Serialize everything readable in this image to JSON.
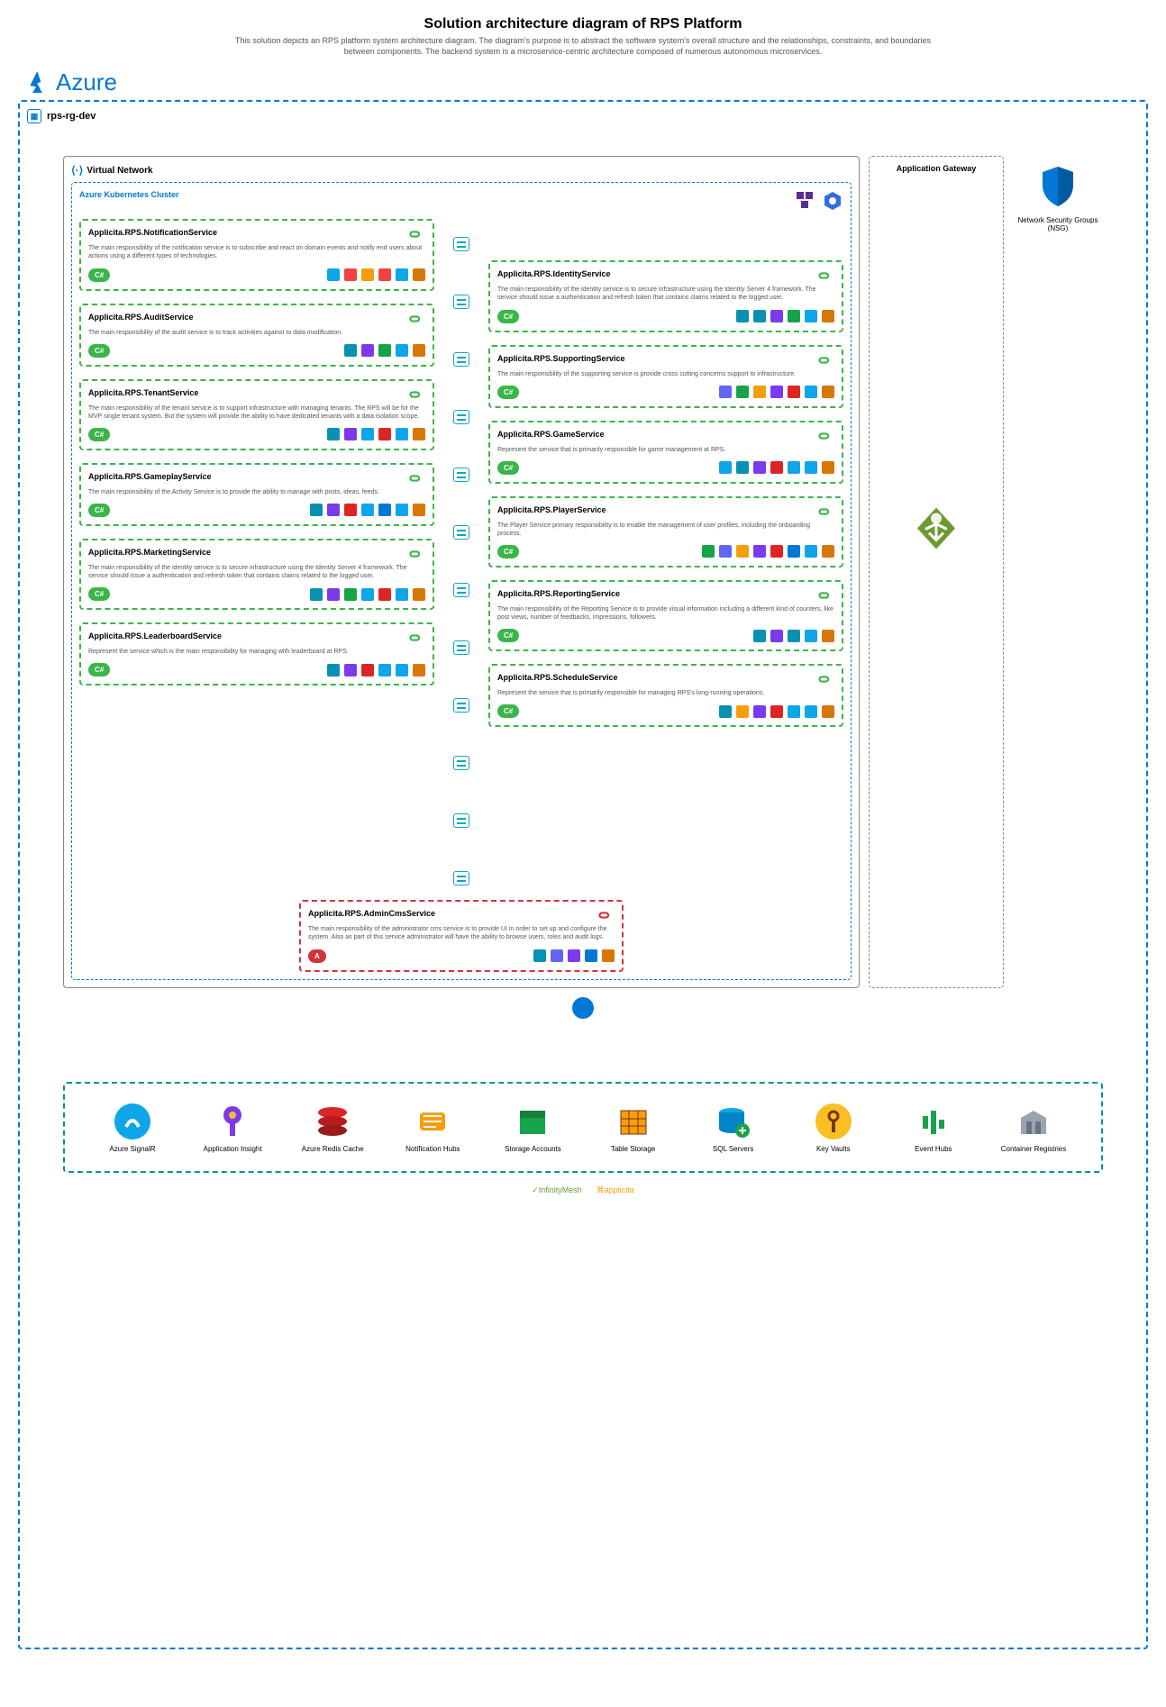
{
  "page": {
    "title": "Solution architecture diagram of RPS Platform",
    "subtitle": "This solution depicts an RPS platform system architecture diagram. The diagram's purpose is to abstract the software system's overall structure and the relationships, constraints, and boundaries between components. The backend system is a microservice-centric architecture composed of numerous autonomous microservices."
  },
  "cloud": {
    "name": "Azure",
    "resource_group": "rps-rg-dev"
  },
  "vnet": {
    "label": "Virtual Network"
  },
  "aks": {
    "label": "Azure Kubernetes Cluster"
  },
  "appgw": {
    "label": "Application Gateway"
  },
  "nsg": {
    "label": "Network Security Groups (NSG)"
  },
  "services_left": [
    {
      "name": "Applicita.RPS.NotificationService",
      "desc": "The main responsibility of the notification service is to subscribe and react on domain events and notify end users about actions using a different types of technologies.",
      "badge": "C#",
      "tech": [
        "signalr",
        "push",
        "mail",
        "twilio",
        "docker",
        "swagger"
      ]
    },
    {
      "name": "Applicita.RPS.AuditService",
      "desc": "The main responsibility of the audit service is to track activities against to data modification.",
      "badge": "C#",
      "tech": [
        "mediatr",
        "hangfire",
        "storage",
        "docker",
        "swagger"
      ]
    },
    {
      "name": "Applicita.RPS.TenantService",
      "desc": "The main responsibility of the tenant service is to support infrastructure with managing tenants. The RPS will be for the MVP single tenant system. But the system will provide the ability to have dedicated tenants with a data isolation scope.",
      "badge": "C#",
      "tech": [
        "mediatr",
        "hangfire",
        "sql",
        "redis",
        "docker",
        "swagger"
      ]
    },
    {
      "name": "Applicita.RPS.GameplayService",
      "desc": "The main responsibility of the Activity Service is to provide the ability to manage with posts, ideas, feeds.",
      "badge": "C#",
      "tech": [
        "mediatr",
        "hangfire",
        "redis",
        "sql",
        "azure",
        "docker",
        "swagger"
      ]
    },
    {
      "name": "Applicita.RPS.MarketingService",
      "desc": "The main responsibility of the identity service is to secure infrastructure using the Identity Server 4 framework. The service should issue a authentication and refresh token that contains claims related to the logged user.",
      "badge": "C#",
      "tech": [
        "mediatr",
        "hangfire",
        "storage",
        "sql",
        "redis",
        "docker",
        "swagger"
      ]
    },
    {
      "name": "Applicita.RPS.LeaderboardService",
      "desc": "Represent the service which is the main responsibility for managing with leaderboard at RPS.",
      "badge": "C#",
      "tech": [
        "mediatr",
        "hangfire",
        "redis",
        "sql",
        "docker",
        "swagger"
      ]
    }
  ],
  "services_right": [
    {
      "name": "Applicita.RPS.IdentityService",
      "desc": "The main responsibility of the identity service is to secure infrastructure using the Identity Server 4 framework. The service should issue a authentication and refresh token that contains claims related to the logged user.",
      "badge": "C#",
      "tech": [
        "identity",
        "mediatr",
        "hangfire",
        "shield",
        "docker",
        "swagger"
      ]
    },
    {
      "name": "Applicita.RPS.SupportingService",
      "desc": "The main responsibility of the supporting service is provide cross cutting concerns support to infrastructure.",
      "badge": "C#",
      "tech": [
        "cube",
        "storage",
        "mail",
        "hangfire",
        "redis",
        "docker",
        "swagger"
      ]
    },
    {
      "name": "Applicita.RPS.GameService",
      "desc": "Represent the service that is primarily responsible for game management at RPS.",
      "badge": "C#",
      "tech": [
        "signalr",
        "mediatr",
        "hangfire",
        "redis",
        "sql",
        "docker",
        "swagger"
      ]
    },
    {
      "name": "Applicita.RPS.PlayerService",
      "desc": "The Player Service primary responsibility is to enable the management of user profiles, including the onboarding process.",
      "badge": "C#",
      "tech": [
        "storage",
        "cube",
        "mail",
        "hangfire",
        "redis",
        "azure",
        "docker",
        "swagger"
      ]
    },
    {
      "name": "Applicita.RPS.ReportingService",
      "desc": "The main responsibility of the Reporting Service is to provide visual information including a different kind of counters, like post views, number of feedbacks, impressions, followers.",
      "badge": "C#",
      "tech": [
        "mediatr",
        "hangfire",
        "chart",
        "docker",
        "swagger"
      ]
    },
    {
      "name": "Applicita.RPS.ScheduleService",
      "desc": "Represent the service that is primarily responsible for managing RPS's long-running operations.",
      "badge": "C#",
      "tech": [
        "mediatr",
        "clock",
        "hangfire",
        "redis",
        "sql",
        "docker",
        "swagger"
      ]
    }
  ],
  "admin_service": {
    "name": "Applicita.RPS.AdminCmsService",
    "desc": "The main responsibility of the administrator cms service is to provide UI in order to set up and configure the system. Also as part of this service administrator will have the ability to browse users, roles and audit logs.",
    "badge": "A",
    "tech": [
      "mediatr",
      "cube",
      "hangfire",
      "azure",
      "swagger"
    ]
  },
  "resources": [
    {
      "label": "Azure SignalR",
      "icon": "signalr"
    },
    {
      "label": "Application Insight",
      "icon": "appinsight"
    },
    {
      "label": "Azure Redis Cache",
      "icon": "redis"
    },
    {
      "label": "Notification Hubs",
      "icon": "nothub"
    },
    {
      "label": "Storage Accounts",
      "icon": "storage"
    },
    {
      "label": "Table Storage",
      "icon": "table"
    },
    {
      "label": "SQL Servers",
      "icon": "sql"
    },
    {
      "label": "Key Vaults",
      "icon": "keyvault"
    },
    {
      "label": "Event Hubs",
      "icon": "eventhub"
    },
    {
      "label": "Container Registries",
      "icon": "acr"
    }
  ],
  "footer": {
    "left": "InfinityMesh",
    "right": "applicita"
  },
  "tech_colors": {
    "signalr": "#0ea5e9",
    "push": "#ef4444",
    "mail": "#f59e0b",
    "twilio": "#ef4444",
    "docker": "#0ea5e9",
    "swagger": "#d97706",
    "mediatr": "#0891b2",
    "hangfire": "#7c3aed",
    "storage": "#16a34a",
    "sql": "#0ea5e9",
    "redis": "#dc2626",
    "azure": "#0078d4",
    "identity": "#0891b2",
    "shield": "#16a34a",
    "cube": "#6366f1",
    "chart": "#0891b2",
    "clock": "#f59e0b"
  }
}
